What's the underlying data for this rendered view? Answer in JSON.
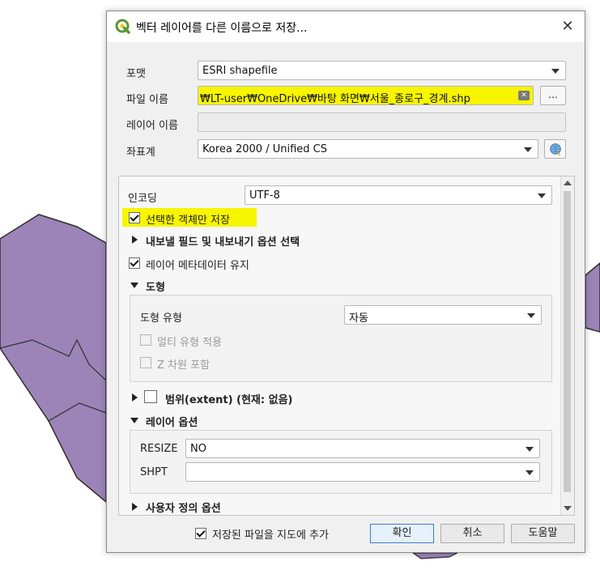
{
  "dialog": {
    "title": "벡터 레이어를 다른 이름으로 저장...",
    "close_glyph": "✕"
  },
  "form": {
    "format_label": "포맷",
    "format_value": "ESRI shapefile",
    "filename_label": "파일 이름",
    "filename_value": "₩LT-user₩OneDrive₩바탕 화면₩서울_종로구_경계.shp",
    "browse_label": "…",
    "layername_label": "레이어 이름",
    "layername_value": "",
    "crs_label": "좌표계",
    "crs_value": "Korea 2000 / Unified CS"
  },
  "panel": {
    "encoding_label": "인코딩",
    "encoding_value": "UTF-8",
    "selected_only_label": "선택한 객체만 저장",
    "selected_only_checked": true,
    "export_fields_label": "내보낼 필드 및 내보내기 옵션 선택",
    "keep_metadata_label": "레이어 메타데이터 유지",
    "keep_metadata_checked": true,
    "geometry_section_label": "도형",
    "geometry_type_label": "도형 유형",
    "geometry_type_value": "자동",
    "multi_type_label": "멀티 유형 적용",
    "z_dimension_label": "Z 차원 포함",
    "extent_label": "범위(extent) (현재: 없음)",
    "layer_options_label": "레이어 옵션",
    "resize_label": "RESIZE",
    "resize_value": "NO",
    "shpt_label": "SHPT",
    "shpt_value": "",
    "custom_options_label": "사용자 정의 옵션"
  },
  "footer": {
    "add_to_map_label": "저장된 파일을 지도에 추가",
    "add_to_map_checked": true,
    "ok_label": "확인",
    "cancel_label": "취소",
    "help_label": "도움말"
  },
  "colors": {
    "polygon_fill": "#9c84b8",
    "polygon_stroke": "#2f2f2f",
    "highlight": "#f8f500",
    "qgis_green": "#589632"
  }
}
